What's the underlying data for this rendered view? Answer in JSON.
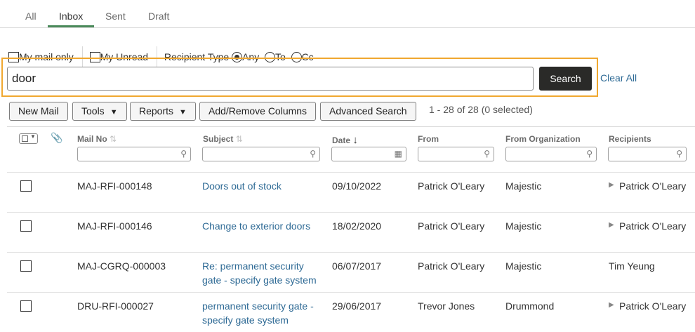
{
  "tabs": [
    "All",
    "Inbox",
    "Sent",
    "Draft"
  ],
  "filters": {
    "my_mail_only": "My mail only",
    "my_unread": "My Unread",
    "recipient_type_label": "Recipient Type",
    "options": [
      "Any",
      "To",
      "Cc"
    ],
    "selected_option": "Any"
  },
  "search": {
    "value": "door",
    "button": "Search",
    "clear_all": "Clear All"
  },
  "toolbar": {
    "new_mail": "New Mail",
    "tools": "Tools",
    "reports": "Reports",
    "add_remove_columns": "Add/Remove Columns",
    "advanced_search": "Advanced Search",
    "result_count": "1 - 28 of 28 (0 selected)"
  },
  "columns": {
    "mail_no": "Mail No",
    "subject": "Subject",
    "date": "Date",
    "from": "From",
    "from_org": "From Organization",
    "recipients": "Recipients"
  },
  "rows": [
    {
      "mail_no": "MAJ-RFI-000148",
      "subject_lines": [
        "Doors out of stock"
      ],
      "date": "09/10/2022",
      "from": "Patrick O'Leary",
      "org": "Majestic",
      "recipient": "Patrick O'Leary",
      "expandable": true
    },
    {
      "mail_no": "MAJ-RFI-000146",
      "subject_lines": [
        "Change to exterior doors"
      ],
      "date": "18/02/2020",
      "from": "Patrick O'Leary",
      "org": "Majestic",
      "recipient": "Patrick O'Leary",
      "expandable": true
    },
    {
      "mail_no": "MAJ-CGRQ-000003",
      "subject_lines": [
        "Re: permanent security",
        "gate - specify gate system"
      ],
      "date": "06/07/2017",
      "from": "Patrick O'Leary",
      "org": "Majestic",
      "recipient": "Tim Yeung",
      "expandable": false
    },
    {
      "mail_no": "DRU-RFI-000027",
      "subject_lines": [
        "permanent security gate -",
        "specify gate system"
      ],
      "date": "29/06/2017",
      "from": "Trevor Jones",
      "org": "Drummond",
      "recipient": "Patrick O'Leary",
      "expandable": true
    }
  ],
  "colors": {
    "accent_tab": "#4a8a5a",
    "highlight": "#f0a830",
    "link": "#2e6a95",
    "search_button": "#2a2a28"
  }
}
